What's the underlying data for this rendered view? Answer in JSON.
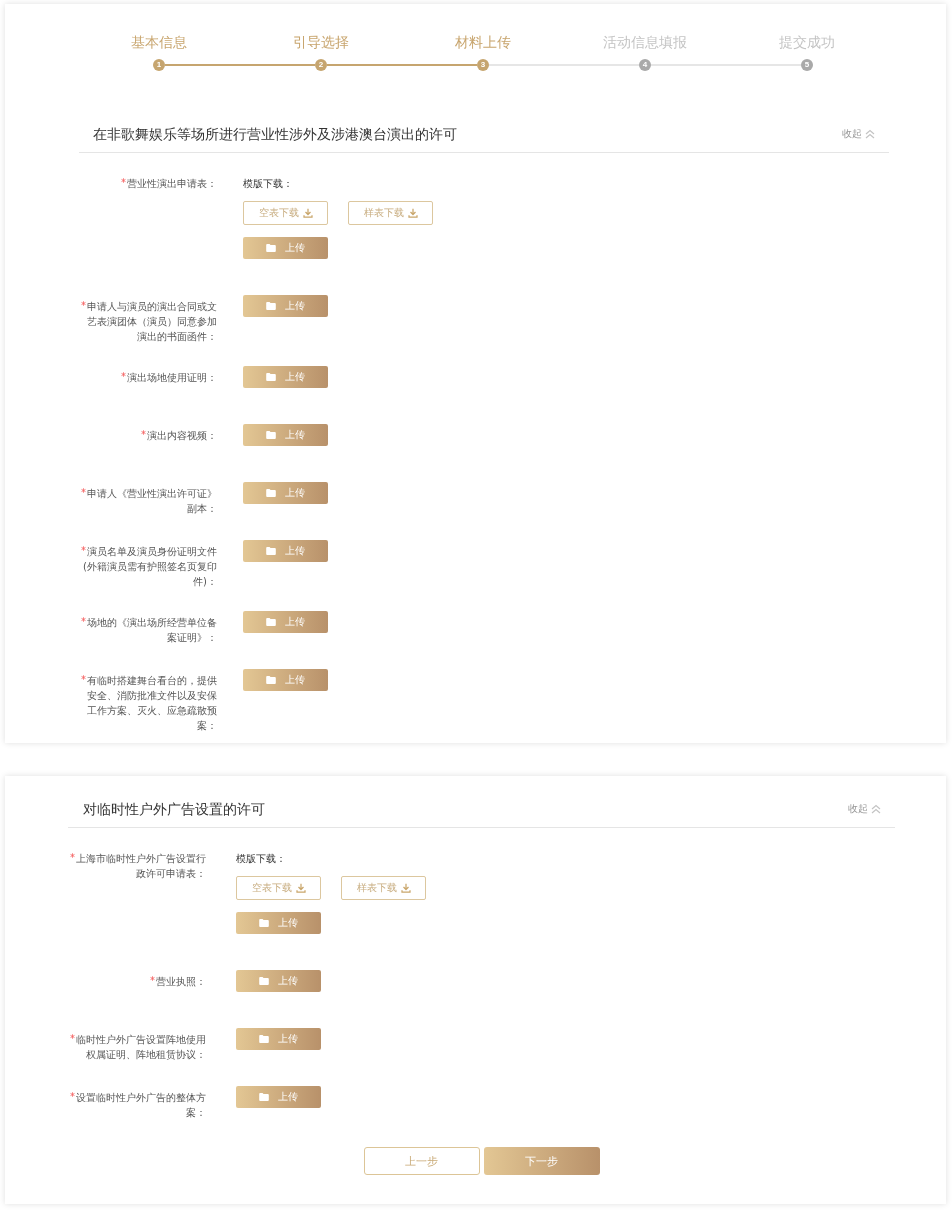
{
  "steps": [
    {
      "label": "基本信息",
      "number": "1",
      "reached": true
    },
    {
      "label": "引导选择",
      "number": "2",
      "reached": true
    },
    {
      "label": "材料上传",
      "number": "3",
      "reached": true
    },
    {
      "label": "活动信息填报",
      "number": "4",
      "reached": false
    },
    {
      "label": "提交成功",
      "number": "5",
      "reached": false
    }
  ],
  "sections": [
    {
      "title": "在非歌舞娱乐等场所进行营业性涉外及涉港澳台演出的许可",
      "toggle_label": "收起",
      "expanded": true,
      "fields": [
        {
          "kind": "template",
          "label": "营业性演出申请表：",
          "required": true,
          "template_label": "模版下载：",
          "downloads": [
            "空表下载",
            "样表下载"
          ],
          "upload": "上传"
        },
        {
          "kind": "upload",
          "label": "申请人与演员的演出合同或文艺表演团体（演员）同意参加演出的书面函件：",
          "required": true,
          "upload": "上传"
        },
        {
          "kind": "upload",
          "label": "演出场地使用证明：",
          "required": true,
          "upload": "上传"
        },
        {
          "kind": "upload",
          "label": "演出内容视频：",
          "required": true,
          "upload": "上传"
        },
        {
          "kind": "upload",
          "label": "申请人《营业性演出许可证》副本：",
          "required": true,
          "upload": "上传"
        },
        {
          "kind": "upload",
          "label": "演员名单及演员身份证明文件(外籍演员需有护照签名页复印件)：",
          "required": true,
          "upload": "上传"
        },
        {
          "kind": "upload",
          "label": "场地的《演出场所经营单位备案证明》：",
          "required": true,
          "upload": "上传"
        },
        {
          "kind": "upload",
          "label": "有临时搭建舞台看台的，提供安全、消防批准文件以及安保工作方案、灭火、应急疏散预案：",
          "required": true,
          "upload": "上传"
        }
      ]
    },
    {
      "title": "对临时性户外广告设置的许可",
      "toggle_label": "收起",
      "expanded": true,
      "fields": [
        {
          "kind": "template",
          "label": "上海市临时性户外广告设置行政许可申请表：",
          "required": true,
          "template_label": "模版下载：",
          "downloads": [
            "空表下载",
            "样表下载"
          ],
          "upload": "上传"
        },
        {
          "kind": "upload",
          "label": "营业执照：",
          "required": true,
          "upload": "上传"
        },
        {
          "kind": "upload",
          "label": "临时性户外广告设置阵地使用权属证明、阵地租赁协议：",
          "required": true,
          "upload": "上传"
        },
        {
          "kind": "upload",
          "label": "设置临时性户外广告的整体方案：",
          "required": true,
          "upload": "上传"
        }
      ]
    }
  ],
  "nav_buttons": [
    {
      "label": "上一步",
      "kind": "secondary"
    },
    {
      "label": "下一步",
      "kind": "primary"
    }
  ]
}
